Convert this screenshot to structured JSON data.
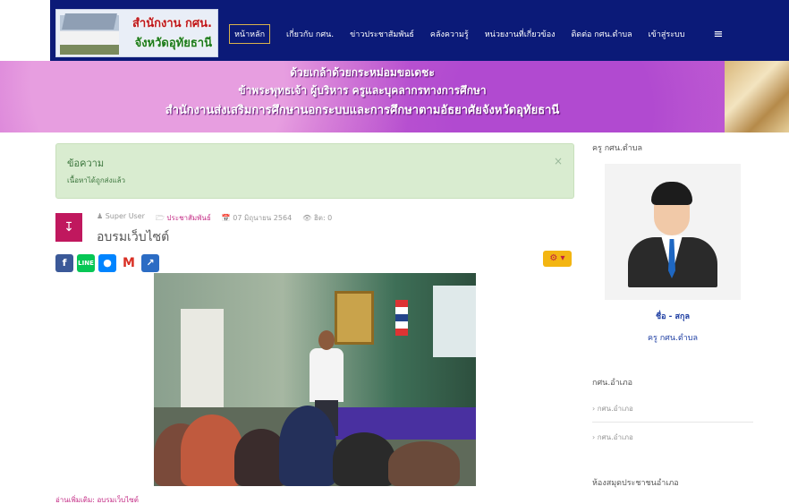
{
  "logo": {
    "line1": "สำนักงาน กศน.",
    "line2": "จังหวัดอุทัยธานี"
  },
  "nav": {
    "items": [
      "หน้าหลัก",
      "เกี่ยวกับ กศน.",
      "ข่าวประชาสัมพันธ์",
      "คลังความรู้",
      "หน่วยงานที่เกี่ยวข้อง",
      "ติดต่อ กศน.ตำบล",
      "เข้าสู่ระบบ"
    ],
    "active": "หน้าหลัก",
    "menu_icon": "≡"
  },
  "banner": {
    "line1": "ด้วยเกล้าด้วยกระหม่อมขอเดชะ",
    "line2": "ข้าพระพุทธเจ้า ผู้บริหาร ครูและบุคลากรทางการศึกษา",
    "line3": "สำนักงานส่งเสริมการศึกษานอกระบบและการศึกษาตามอัธยาศัยจังหวัดอุทัยธานี"
  },
  "alert": {
    "title": "ข้อความ",
    "message": "เนื้อหาได้ถูกส่งแล้ว",
    "close": "×"
  },
  "article": {
    "author": "Super User",
    "category": "ประชาสัมพันธ์",
    "date": "07 มิถุนายน 2564",
    "hits": "ฮิต: 0",
    "title": "อบรมเว็บไซต์",
    "read_more": "อ่านเพิ่มเติม: อบรมเว็บไซต์",
    "share_icons": [
      "facebook-icon",
      "line-icon",
      "messenger-icon",
      "gmail-icon",
      "share-icon"
    ],
    "tools_icon": "gear-icon"
  },
  "sidebar": {
    "teacher_heading": "ครู กศน.ตำบล",
    "teacher_name": "ชื่อ - สกุล",
    "teacher_role": "ครู กศน.ตำบล",
    "district_heading": "กศน.อำเภอ",
    "district_items": [
      "กศน.อำเภอ",
      "กศน.อำเภอ"
    ],
    "library_heading": "ห้องสมุดประชาชนอำเภอ"
  }
}
